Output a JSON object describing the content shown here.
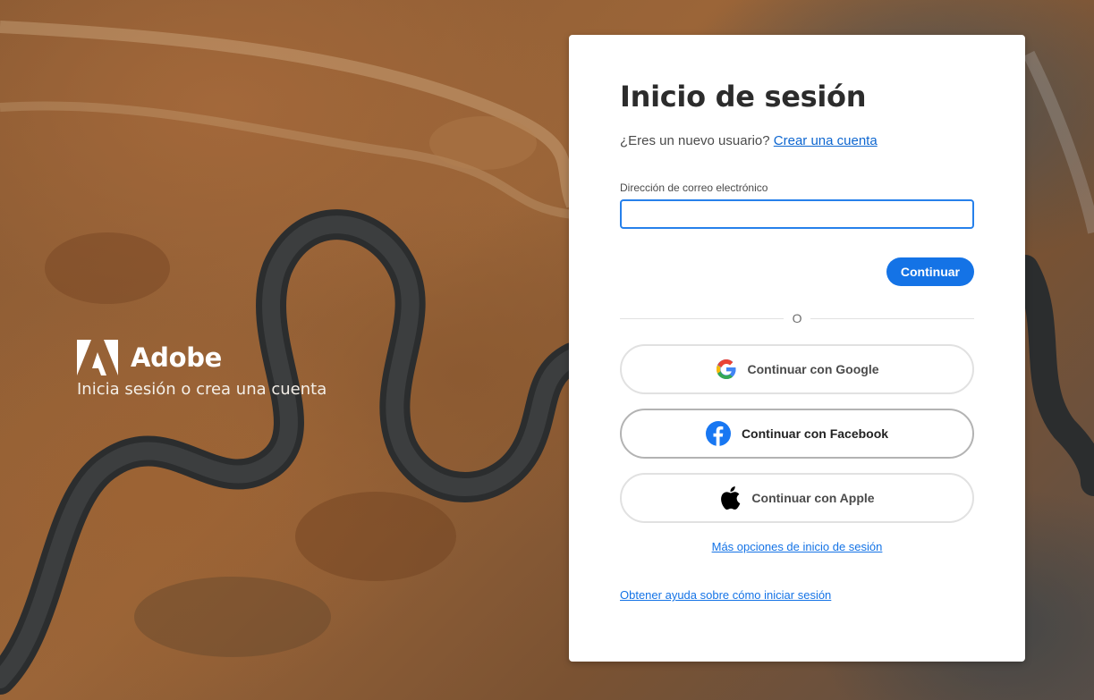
{
  "brand": {
    "name": "Adobe",
    "tagline": "Inicia sesión o crea una cuenta",
    "logo_icon": "adobe-logo-icon"
  },
  "signin": {
    "title": "Inicio de sesión",
    "new_user_prompt": "¿Eres un nuevo usuario?",
    "create_account_link": "Crear una cuenta",
    "email_label": "Dirección de correo electrónico",
    "email_value": "",
    "continue_label": "Continuar",
    "divider_text": "O",
    "social_buttons": [
      {
        "label": "Continuar con Google",
        "icon": "google-icon"
      },
      {
        "label": "Continuar con Facebook",
        "icon": "facebook-icon"
      },
      {
        "label": "Continuar con Apple",
        "icon": "apple-icon"
      }
    ],
    "more_options_link": "Más opciones de inicio de sesión",
    "help_link": "Obtener ayuda sobre cómo iniciar sesión"
  },
  "colors": {
    "accent": "#1473e6",
    "link": "#0d66d0",
    "card_bg": "#ffffff",
    "facebook": "#1877f2"
  }
}
